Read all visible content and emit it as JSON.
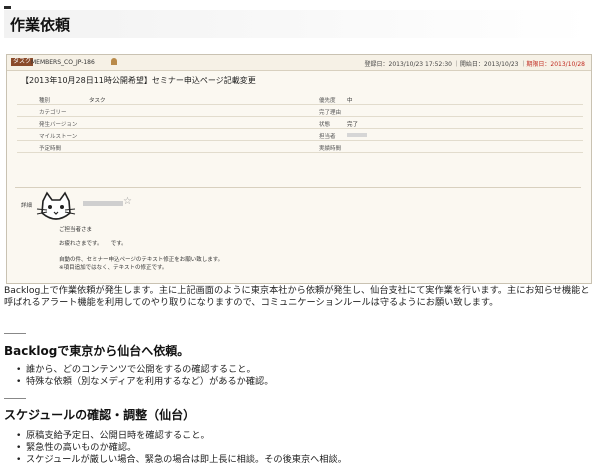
{
  "page": {
    "title": "作業依頼"
  },
  "screenshot": {
    "tag": "タスク",
    "issue_key": "MEMBERS_CO_JP-186",
    "registered": "登録日：2013/10/23 17:52:30",
    "start": "開始日：2013/10/23",
    "due": "期限日：2013/10/28",
    "summary": "【2013年10月28日11時公開希望】セミナー申込ページ記載変更",
    "fields": [
      {
        "l1": "種別",
        "v1": "タスク",
        "l2": "優先度",
        "v2": "中"
      },
      {
        "l1": "カテゴリー",
        "v1": "",
        "l2": "完了理由",
        "v2": ""
      },
      {
        "l1": "発生バージョン",
        "v1": "",
        "l2": "状態",
        "v2": "完了"
      },
      {
        "l1": "マイルストーン",
        "v1": "",
        "l2": "担当者",
        "v2": ""
      },
      {
        "l1": "予定時間",
        "v1": "",
        "l2": "実績時間",
        "v2": ""
      }
    ],
    "detail_label": "詳細",
    "message": [
      "ご担当者さま",
      "お疲れさまです。　　です。",
      "自動の件、セミナー申込ページのテキスト修正をお願い致します。",
      "※項目追加ではなく、テキストの修正です。"
    ]
  },
  "intro": "Backlog上で作業依頼が発生します。主に上記画面のように東京本社から依頼が発生し、仙台支社にて実作業を行います。主にお知らせ機能と呼ばれるアラート機能を利用してのやり取りになりますので、コミュニケーションルールは守るようにお願い致します。",
  "sections": [
    {
      "heading": "Backlogで東京から仙台へ依頼。",
      "items": [
        "誰から、どのコンテンツで公開をするの確認すること。",
        "特殊な依頼（別なメディアを利用するなど）があるか確認。"
      ]
    },
    {
      "heading": "スケジュールの確認・調整（仙台）",
      "items": [
        "原稿支給予定日、公開日時を確認すること。",
        "緊急性の高いものか確認。",
        "スケジュールが厳しい場合、緊急の場合は即上長に相談。その後東京へ相談。"
      ]
    }
  ]
}
